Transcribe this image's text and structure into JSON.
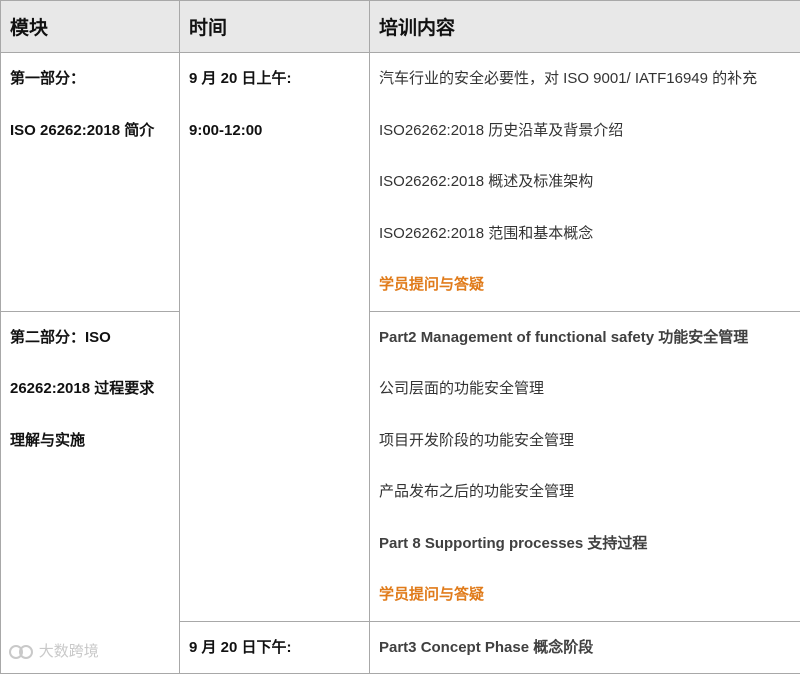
{
  "table": {
    "headers": [
      "模块",
      "时间",
      "培训内容"
    ],
    "module1": [
      "第一部分：",
      "ISO 26262:2018 简介"
    ],
    "module2": [
      "第二部分：ISO",
      "26262:2018 过程要求",
      "理解与实施"
    ],
    "time1": [
      "9 月 20 日上午:",
      "9:00-12:00"
    ],
    "time2": "9 月 20 日下午:",
    "content1": [
      "汽车行业的安全必要性，对 ISO 9001/ IATF16949 的补充",
      "ISO26262:2018  历史沿革及背景介绍",
      "ISO26262:2018  概述及标准架构",
      "ISO26262:2018  范围和基本概念",
      "学员提问与答疑"
    ],
    "content2": [
      "Part2  Management of functional safety 功能安全管理",
      "公司层面的功能安全管理",
      "项目开发阶段的功能安全管理",
      "产品发布之后的功能安全管理",
      "Part 8 Supporting processes  支持过程",
      "学员提问与答疑"
    ],
    "content3": "Part3 Concept Phase  概念阶段"
  },
  "watermark": "大数跨境"
}
